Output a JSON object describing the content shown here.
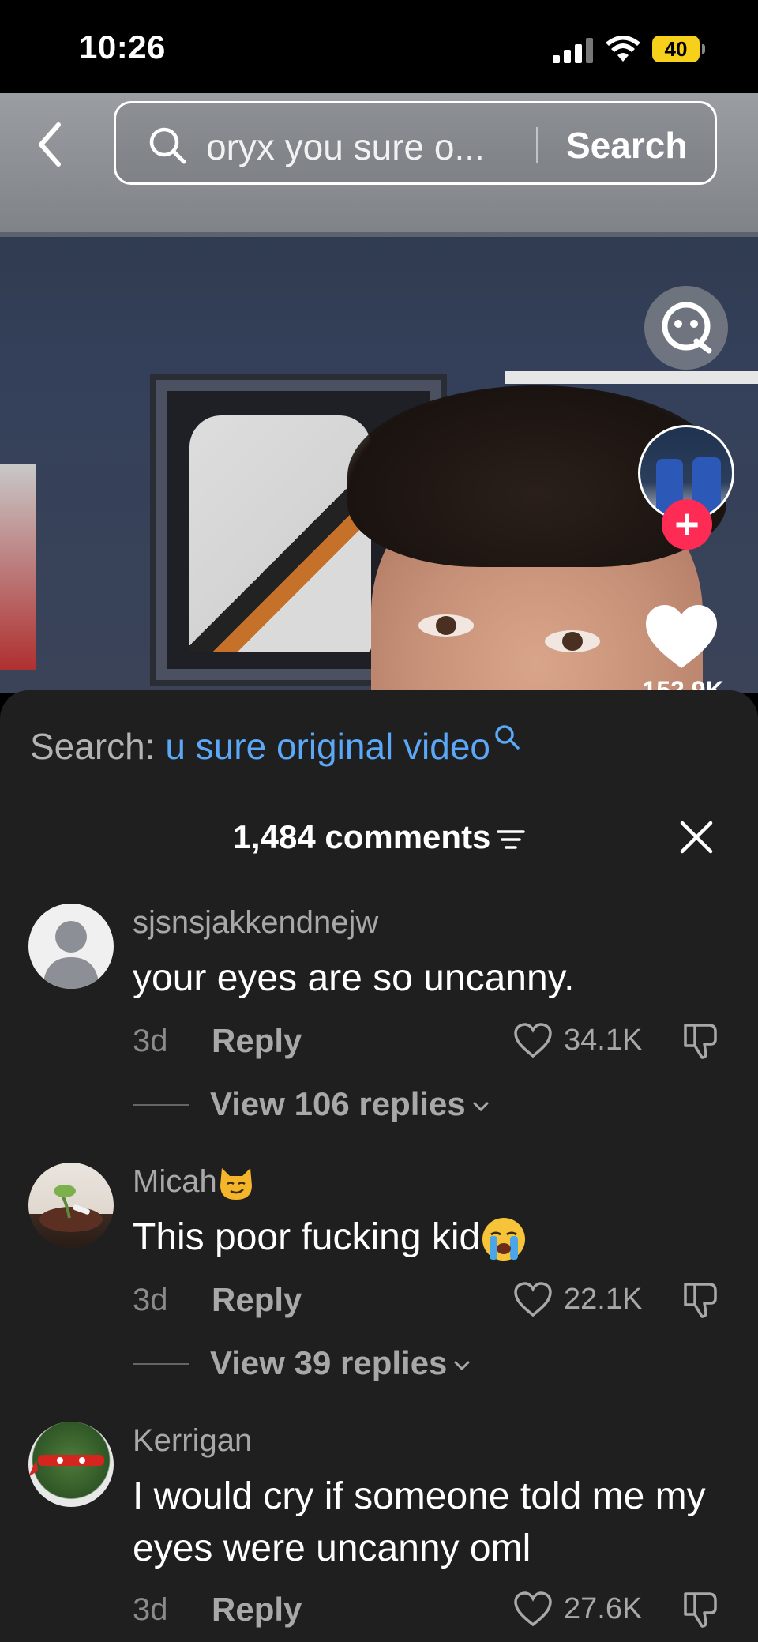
{
  "status_bar": {
    "time": "10:26",
    "battery": "40"
  },
  "search": {
    "query": "oryx you sure o...",
    "button_label": "Search"
  },
  "video": {
    "like_count": "152.9K"
  },
  "related_search": {
    "label": "Search:",
    "term": "u sure original video"
  },
  "comments_header": {
    "title": "1,484 comments"
  },
  "comments": [
    {
      "username": "sjsnsjakkendnejw",
      "text": "your eyes are so uncanny.",
      "age": "3d",
      "reply_label": "Reply",
      "likes": "34.1K",
      "view_replies": "View 106 replies"
    },
    {
      "username": "Micah",
      "text": "This poor fucking kid",
      "age": "3d",
      "reply_label": "Reply",
      "likes": "22.1K",
      "view_replies": "View 39 replies"
    },
    {
      "username": "Kerrigan",
      "text": "I would cry if someone told me my eyes were uncanny oml",
      "age": "3d",
      "reply_label": "Reply",
      "likes": "27.6K"
    }
  ],
  "colors": {
    "accent_link": "#5aa8f7",
    "follow_red": "#fe2c55",
    "battery_yellow": "#f7d01b",
    "sheet_bg": "#1f1f1f"
  }
}
